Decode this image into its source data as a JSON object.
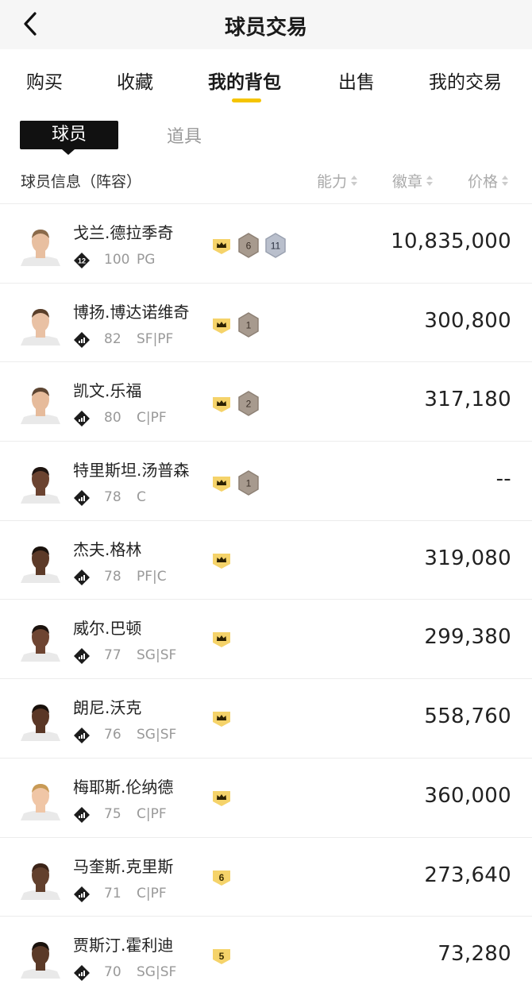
{
  "header": {
    "title": "球员交易"
  },
  "tabs": [
    "购买",
    "收藏",
    "我的背包",
    "出售",
    "我的交易"
  ],
  "active_tab": "我的背包",
  "subtabs": {
    "active": "球员",
    "inactive": "道具"
  },
  "columns": {
    "info": "球员信息（阵容）",
    "ability": "能力",
    "badge": "徽章",
    "price": "价格"
  },
  "colors": {
    "accent": "#f5c400",
    "badge_gold": "#f5d36a",
    "badge_bronze": "#a79a8e",
    "badge_silver": "#b9bfcc"
  },
  "players": [
    {
      "name": "戈兰.德拉季奇",
      "ovr": "100",
      "pos": "PG",
      "rating_icon": "12",
      "price": "10,835,000",
      "badges": [
        {
          "type": "crown"
        },
        {
          "type": "bronze",
          "text": "6"
        },
        {
          "type": "silver",
          "text": "11"
        }
      ],
      "skin": "#e8bfa0",
      "hair": "#8a6a4a"
    },
    {
      "name": "博扬.博达诺维奇",
      "ovr": "82",
      "pos": "SF|PF",
      "rating_icon": "signal",
      "price": "300,800",
      "badges": [
        {
          "type": "crown"
        },
        {
          "type": "bronze",
          "text": "1"
        }
      ],
      "skin": "#e9c1a4",
      "hair": "#5a3f2a"
    },
    {
      "name": "凯文.乐福",
      "ovr": "80",
      "pos": "C|PF",
      "rating_icon": "signal",
      "price": "317,180",
      "badges": [
        {
          "type": "crown"
        },
        {
          "type": "bronze",
          "text": "2"
        }
      ],
      "skin": "#e6bb9b",
      "hair": "#5d4532"
    },
    {
      "name": "特里斯坦.汤普森",
      "ovr": "78",
      "pos": "C",
      "rating_icon": "signal",
      "price": "--",
      "badges": [
        {
          "type": "crown"
        },
        {
          "type": "bronze",
          "text": "1"
        }
      ],
      "skin": "#6b4330",
      "hair": "#1e1410"
    },
    {
      "name": "杰夫.格林",
      "ovr": "78",
      "pos": "PF|C",
      "rating_icon": "signal",
      "price": "319,080",
      "badges": [
        {
          "type": "crown"
        }
      ],
      "skin": "#5c3a28",
      "hair": "#1a120d"
    },
    {
      "name": "威尔.巴顿",
      "ovr": "77",
      "pos": "SG|SF",
      "rating_icon": "signal",
      "price": "299,380",
      "badges": [
        {
          "type": "crown"
        }
      ],
      "skin": "#6e4532",
      "hair": "#1c130e"
    },
    {
      "name": "朗尼.沃克",
      "ovr": "76",
      "pos": "SG|SF",
      "rating_icon": "signal",
      "price": "558,760",
      "badges": [
        {
          "type": "crown"
        }
      ],
      "skin": "#5a3726",
      "hair": "#18100b"
    },
    {
      "name": "梅耶斯.伦纳德",
      "ovr": "75",
      "pos": "C|PF",
      "rating_icon": "signal",
      "price": "360,000",
      "badges": [
        {
          "type": "crown"
        }
      ],
      "skin": "#f0c6a6",
      "hair": "#c89a55"
    },
    {
      "name": "马奎斯.克里斯",
      "ovr": "71",
      "pos": "C|PF",
      "rating_icon": "signal",
      "price": "273,640",
      "badges": [
        {
          "type": "gold",
          "text": "6"
        }
      ],
      "skin": "#62402d",
      "hair": "#3b2418"
    },
    {
      "name": "贾斯汀.霍利迪",
      "ovr": "70",
      "pos": "SG|SF",
      "rating_icon": "signal",
      "price": "73,280",
      "badges": [
        {
          "type": "gold",
          "text": "5"
        }
      ],
      "skin": "#5b3a28",
      "hair": "#1a120d"
    }
  ]
}
